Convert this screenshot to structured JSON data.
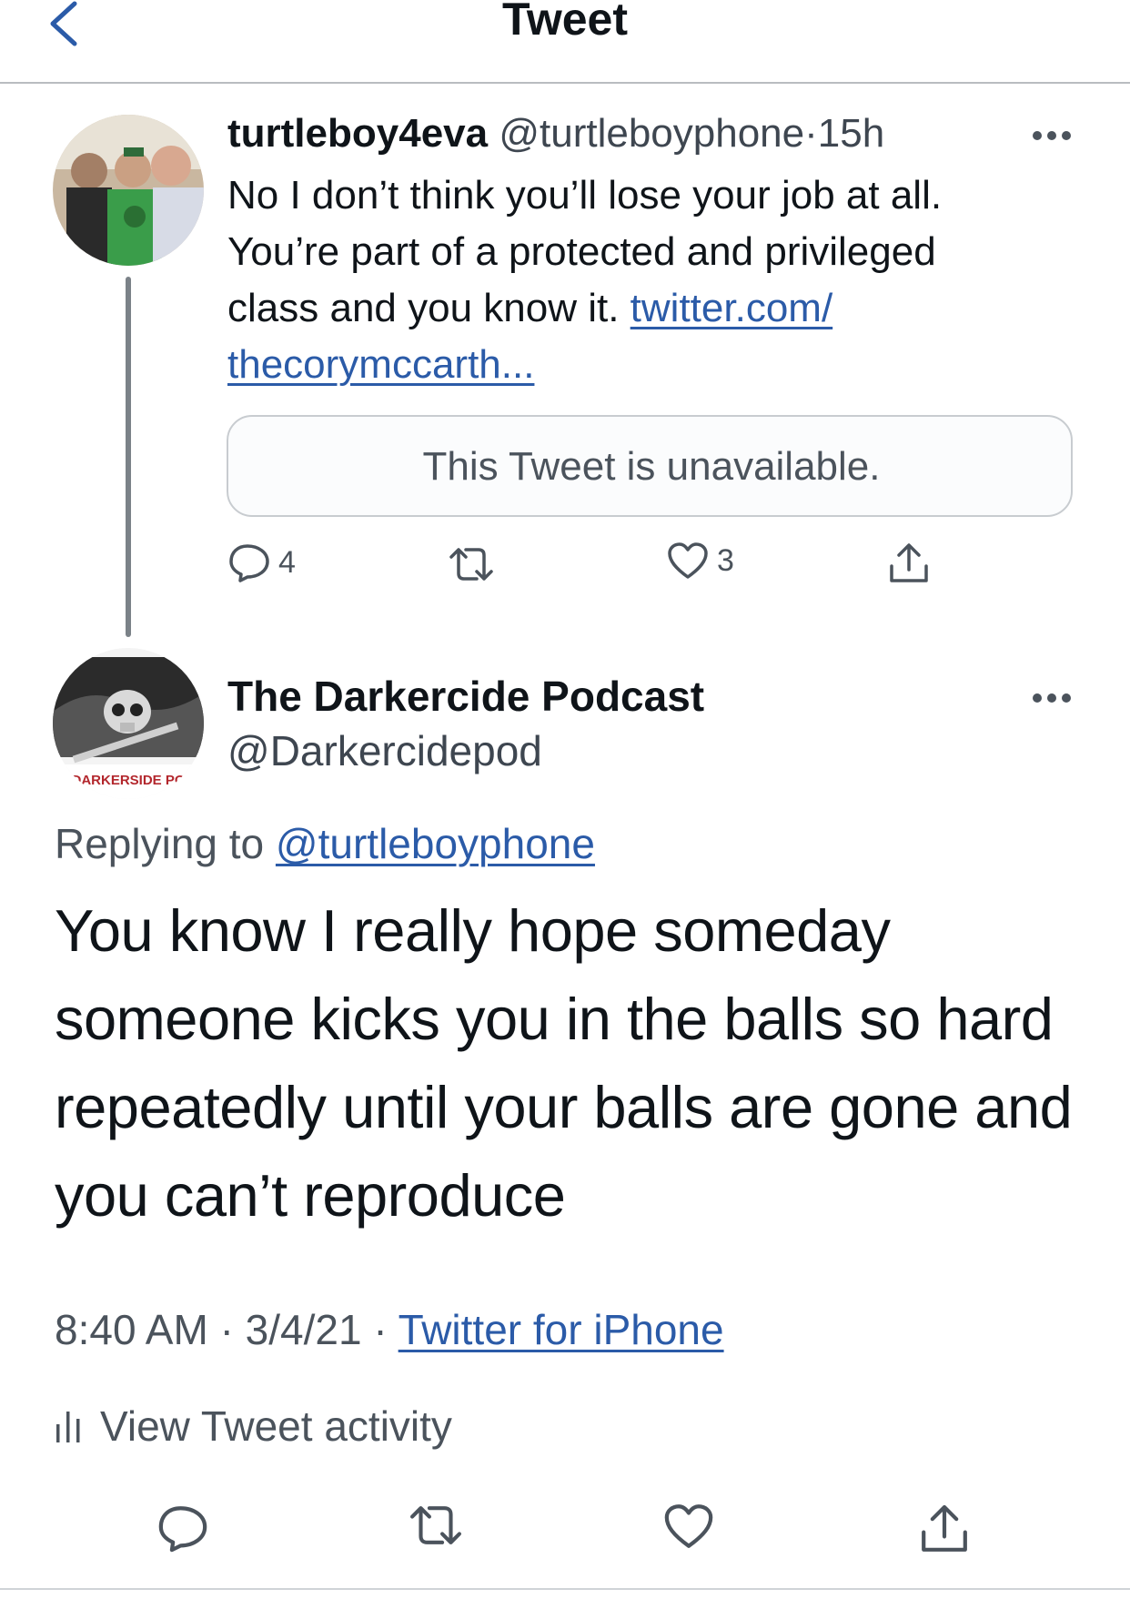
{
  "header": {
    "title": "Tweet",
    "back_icon": "chevron-left-icon"
  },
  "tweet1": {
    "display_name": "turtleboy4eva",
    "handle": "@turtleboyphone",
    "separator": "·",
    "time": "15h",
    "text_lines": [
      "No I don’t think you’ll lose your job at all.",
      "You’re part of a protected and privileged",
      "class and you know it. "
    ],
    "link_part1": "twitter.com/",
    "link_part2": "thecorymccarth...",
    "quote_text": "This Tweet is unavailable.",
    "reply_count": "4",
    "retweet_count": "",
    "like_count": "3"
  },
  "tweet2": {
    "display_name": "The Darkercide Podcast",
    "handle": "@Darkercidepod",
    "avatar_caption": "DARKERSIDE PO",
    "replying_prefix": "Replying to ",
    "replying_handle": "@turtleboyphone",
    "text": "You know I really hope someday someone kicks you in the balls so hard repeatedly until your balls are gone and you can’t reproduce",
    "time": "8:40 AM",
    "date": "3/4/21",
    "separator": "·",
    "client": "Twitter for iPhone",
    "activity_label": "View Tweet activity"
  },
  "colors": {
    "text": "#0f1419",
    "secondary": "#4b535c",
    "link": "#2b5ba8",
    "border": "#c8ccd0"
  },
  "icons": [
    "chevron-left-icon",
    "more-icon",
    "reply-icon",
    "retweet-icon",
    "like-icon",
    "share-icon",
    "bar-chart-icon"
  ]
}
